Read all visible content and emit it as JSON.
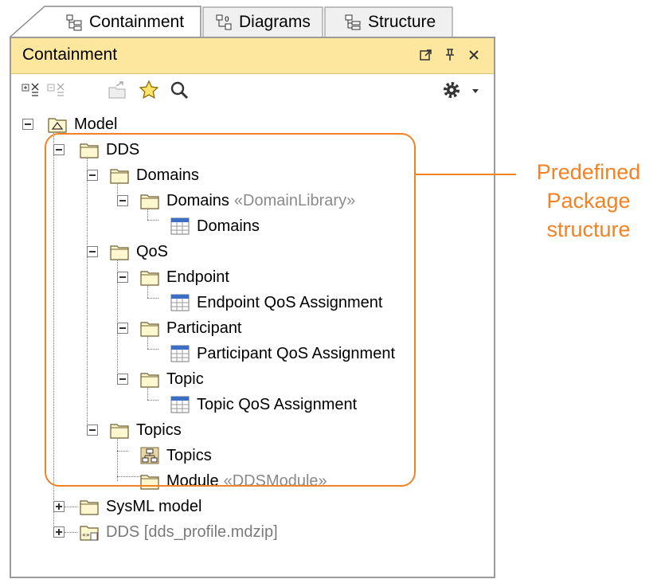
{
  "tabs": [
    {
      "label": "Containment",
      "icon": "containment-icon",
      "active": true
    },
    {
      "label": "Diagrams",
      "icon": "diagrams-icon",
      "active": false
    },
    {
      "label": "Structure",
      "icon": "structure-icon",
      "active": false
    }
  ],
  "panel": {
    "title": "Containment"
  },
  "toolbar": {
    "tools": [
      "expand-icon",
      "collapse-icon",
      "export-icon",
      "star-icon",
      "search-icon",
      "gear-icon",
      "dropdown-arrow-icon"
    ]
  },
  "tree": {
    "model": "Model",
    "dds": "DDS",
    "domains_pkg": "Domains",
    "domains_lib": "Domains",
    "domains_lib_stereo": "«DomainLibrary»",
    "domains_table": "Domains",
    "qos": "QoS",
    "endpoint": "Endpoint",
    "endpoint_table": "Endpoint QoS Assignment",
    "participant": "Participant",
    "participant_table": "Participant QoS Assignment",
    "topic": "Topic",
    "topic_table": "Topic QoS Assignment",
    "topics_pkg": "Topics",
    "topics_diagram": "Topics",
    "module": "Module",
    "module_stereo": "«DDSModule»",
    "sysml": "SysML model",
    "profile": "DDS [dds_profile.mdzip]"
  },
  "annotation": {
    "line1": "Predefined",
    "line2": "Package",
    "line3": "structure",
    "color": "#f28224"
  },
  "colors": {
    "titlebar": "#fde79f",
    "folder": "#fff7cf",
    "folder_stroke": "#8a7a3a"
  }
}
